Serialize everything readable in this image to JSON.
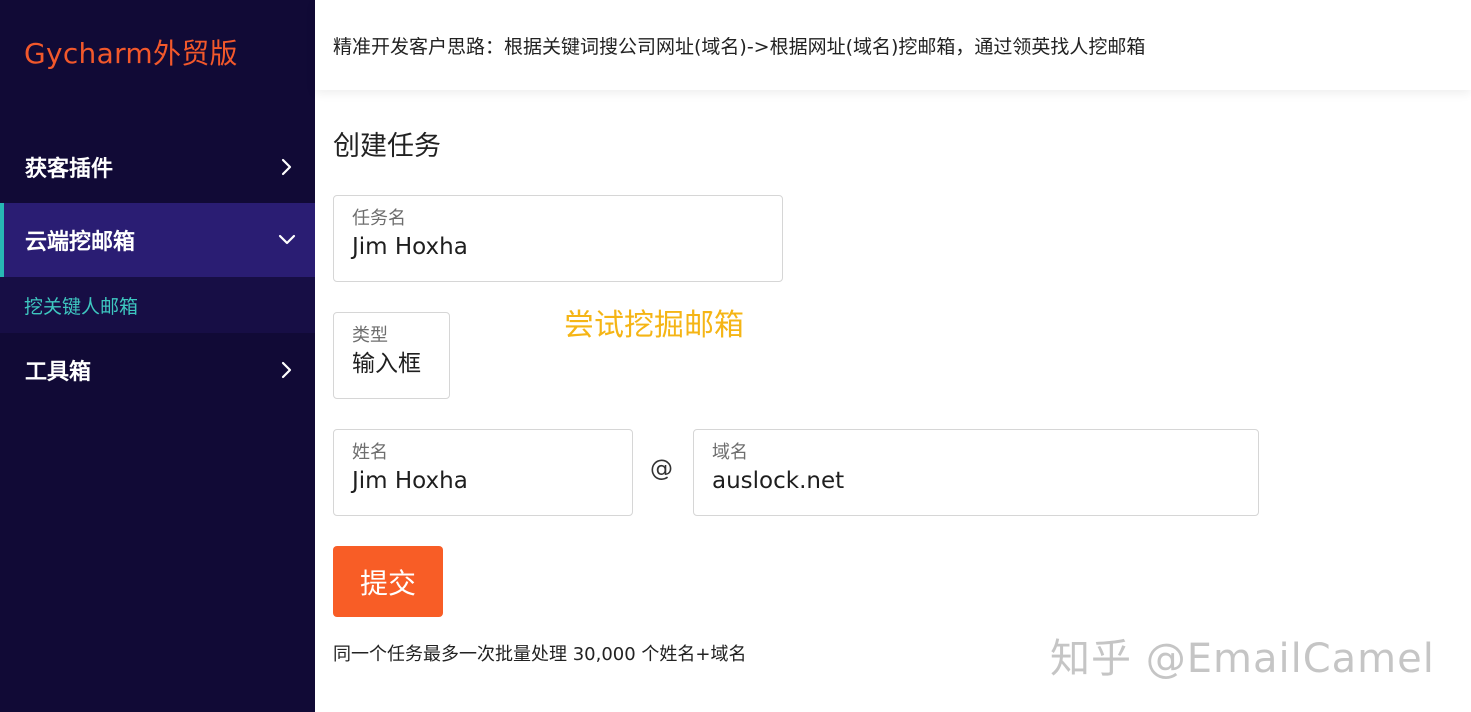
{
  "brand": "Gycharm外贸版",
  "sidebar": {
    "items": [
      {
        "label": "获客插件",
        "icon": "chevron-right-icon"
      },
      {
        "label": "云端挖邮箱",
        "icon": "chevron-down-icon",
        "active": true
      },
      {
        "label": "工具箱",
        "icon": "chevron-right-icon"
      }
    ],
    "subitem": {
      "label": "挖关键人邮箱"
    }
  },
  "topbar": {
    "text": "精准开发客户思路：根据关键词搜公司网址(域名)->根据网址(域名)挖邮箱，通过领英找人挖邮箱"
  },
  "page": {
    "title": "创建任务",
    "task_name": {
      "label": "任务名",
      "value": "Jim Hoxha"
    },
    "type": {
      "label": "类型",
      "value": "输入框"
    },
    "person_name": {
      "label": "姓名",
      "value": "Jim Hoxha"
    },
    "at_symbol": "@",
    "domain": {
      "label": "域名",
      "value": "auslock.net"
    },
    "hint": "尝试挖掘邮箱",
    "submit_label": "提交",
    "note": "同一个任务最多一次批量处理 30,000 个姓名+域名"
  },
  "watermark": "知乎 @EmailCamel",
  "colors": {
    "sidebar_bg": "#110a36",
    "active_item_bg": "#2a1d73",
    "active_indicator": "#27b8b4",
    "subitem_text": "#3ec7c0",
    "brand": "#f2582b",
    "submit_bg": "#f85d26",
    "hint_text": "#f5b515"
  }
}
